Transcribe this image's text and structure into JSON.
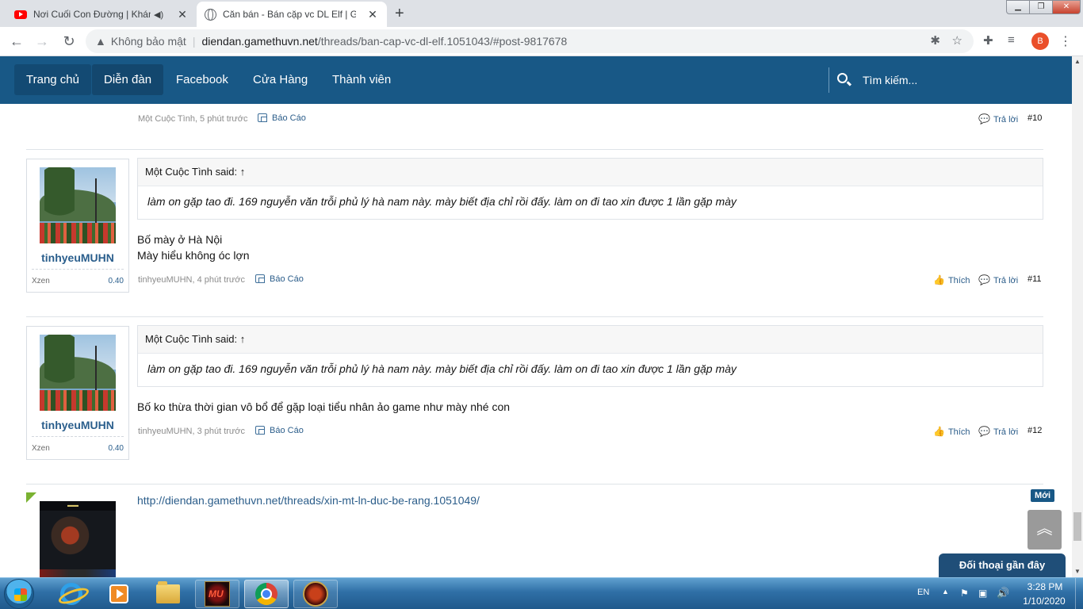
{
  "browser": {
    "tabs": [
      {
        "title": "Nơi Cuối Con Đường | Khánh",
        "icon": "youtube-icon"
      },
      {
        "title": "Căn bán - Bán cặp vc DL Elf | Gam",
        "icon": "globe-icon"
      }
    ],
    "security_label": "Không bảo mật",
    "url_domain": "diendan.gamethuvn.net",
    "url_path": "/threads/ban-cap-vc-dl-elf.1051043/#post-9817678",
    "profile_initial": "B"
  },
  "nav": {
    "items": [
      "Trang chủ",
      "Diễn đàn",
      "Facebook",
      "Cửa Hàng",
      "Thành viên"
    ],
    "search_label": "Tìm kiếm..."
  },
  "post10": {
    "meta": "Một Cuộc Tình, 5 phút trước",
    "report": "Báo Cáo",
    "reply": "Trả lời",
    "number": "#10"
  },
  "post11": {
    "username": "tinhyeuMUHN",
    "user_title": "Xzen",
    "user_score": "0.40",
    "quote_author": "Một Cuộc Tình said: ↑",
    "quote_text": "làm on gặp tao đi. 169 nguyễn văn trỗi phủ lý hà nam này. mày biết địa chỉ rồi đấy. làm on đi tao xin được 1 lần gặp mày",
    "message_lines": [
      "Bố mày ở Hà Nội",
      "Mày hiểu không óc lợn"
    ],
    "meta": "tinhyeuMUHN, 4 phút trước",
    "report": "Báo Cáo",
    "like": "Thích",
    "reply": "Trả lời",
    "number": "#11"
  },
  "post12": {
    "username": "tinhyeuMUHN",
    "user_title": "Xzen",
    "user_score": "0.40",
    "quote_author": "Một Cuộc Tình said: ↑",
    "quote_text": "làm on gặp tao đi. 169 nguyễn văn trỗi phủ lý hà nam này. mày biết địa chỉ rồi đấy. làm on đi tao xin được 1 lần gặp mày",
    "message": "Bố ko thừa thời gian vô bổ để gặp loại tiểu nhân ảo game như mày nhé con",
    "meta": "tinhyeuMUHN, 3 phút trước",
    "report": "Báo Cáo",
    "like": "Thích",
    "reply": "Trả lời",
    "number": "#12"
  },
  "post13": {
    "link": "http://diendan.gamethuvn.net/threads/xin-mt-ln-duc-be-rang.1051049/",
    "new_badge": "Mới"
  },
  "widgets": {
    "recent_chat": "Đối thoại gần đây"
  },
  "taskbar": {
    "language": "EN",
    "time": "3:28 PM",
    "date": "1/10/2020"
  },
  "colors": {
    "nav_bg": "#185886",
    "link": "#2b5d8a",
    "new_badge": "#185886"
  }
}
